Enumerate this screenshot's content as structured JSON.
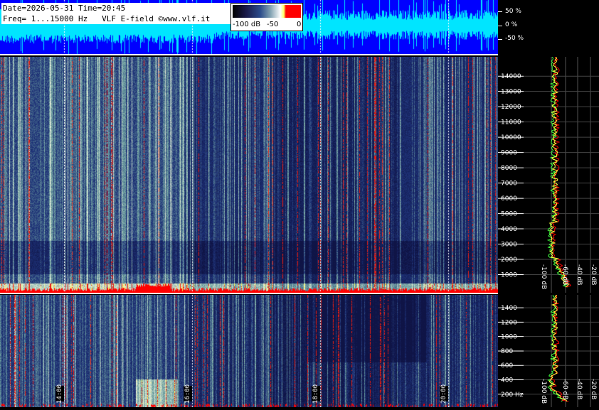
{
  "header": {
    "date_line": "Date=2026-05-31 Time=20:45",
    "freq_line": "Freq= 1...15000 Hz   VLF E-field ©www.vlf.it"
  },
  "color_scale": {
    "labels": [
      "-100 dB",
      "-50",
      "0"
    ]
  },
  "amplitude_axis": {
    "labels": [
      "50 %",
      "0 %",
      "-50 %"
    ]
  },
  "time_axis": {
    "labels": [
      "14:00",
      "16:00",
      "18:00",
      "20:00"
    ]
  },
  "freq_axis_top": {
    "labels": [
      "14000",
      "13000",
      "12000",
      "11000",
      "10000",
      "9000",
      "8000",
      "7000",
      "6000",
      "5000",
      "4000",
      "3000",
      "2000",
      "1000"
    ],
    "values": [
      14000,
      13000,
      12000,
      11000,
      10000,
      9000,
      8000,
      7000,
      6000,
      5000,
      4000,
      3000,
      2000,
      1000
    ]
  },
  "freq_axis_bottom": {
    "labels": [
      "1400",
      "1200",
      "1000",
      "800",
      "600",
      "400",
      "200 Hz"
    ],
    "values": [
      1400,
      1200,
      1000,
      800,
      600,
      400,
      200
    ]
  },
  "db_axis_top": {
    "labels": [
      "-100 dB",
      "-60 dB",
      "-40 dB",
      "-20 dB"
    ]
  },
  "db_axis_bottom": {
    "labels": [
      "-100 dB",
      "-60 dB",
      "-40 dB",
      "-20 dB"
    ]
  },
  "colors": {
    "wave_bg": "#0000ff",
    "wave_signal": "#00e5ff",
    "spectrum_red": "#ff0000",
    "spectrum_yellow": "#ffff40",
    "spectrum_green": "#40ff40"
  }
}
